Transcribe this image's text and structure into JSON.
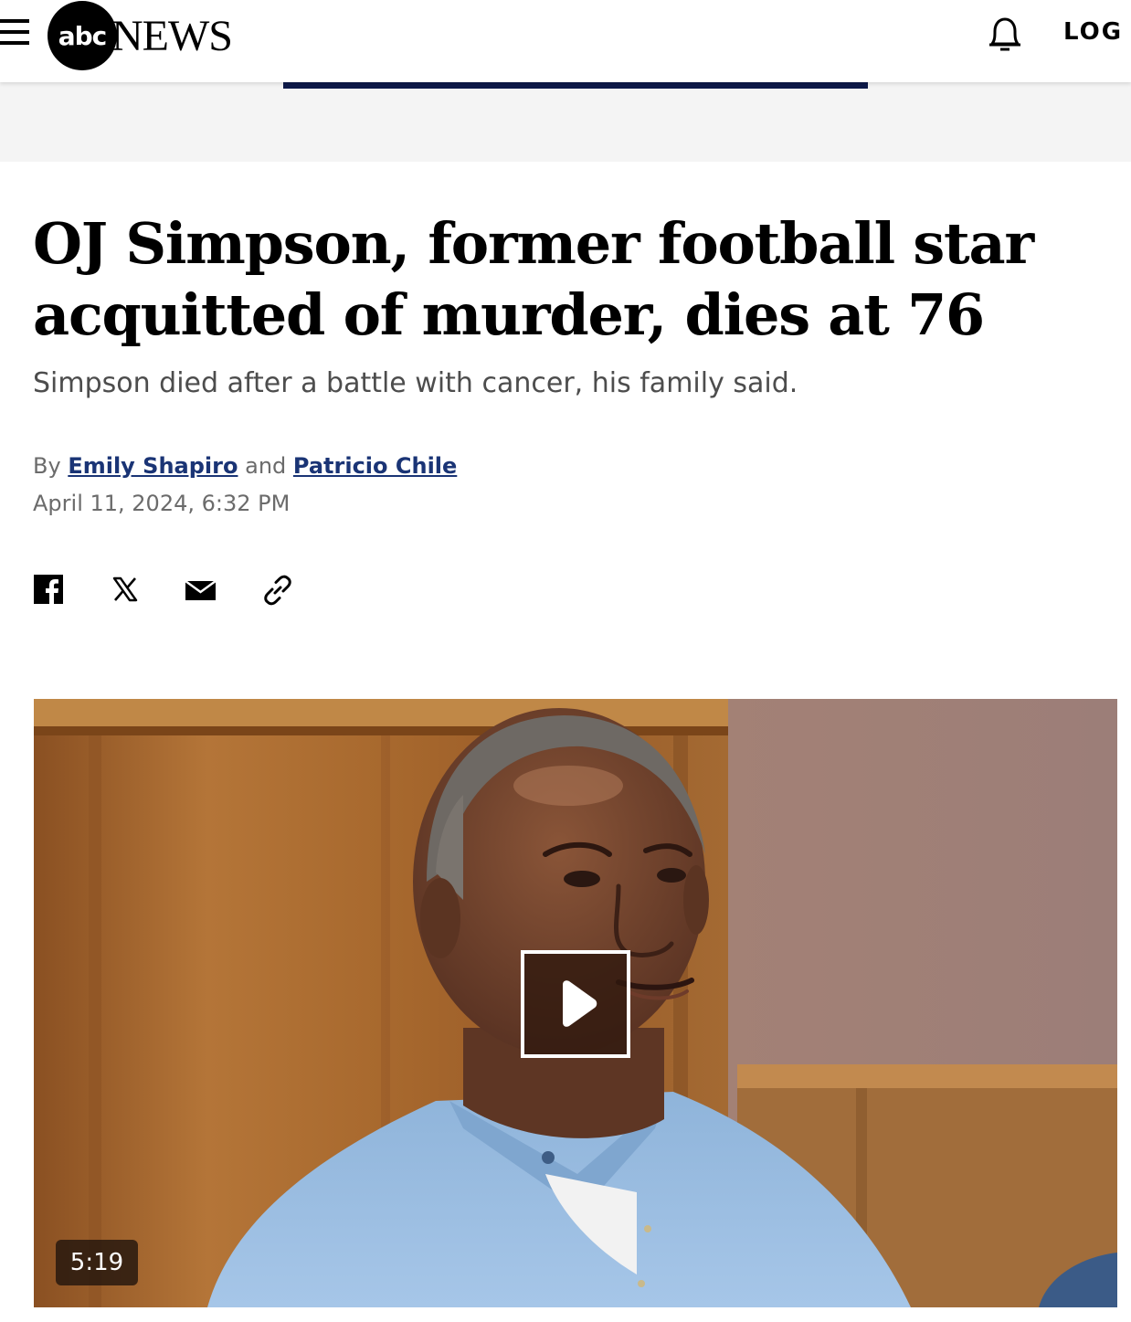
{
  "header": {
    "logo_mark": "abc",
    "logo_wordmark": "NEWS",
    "login_label": "LOG I",
    "icons": [
      "menu-icon",
      "bell-icon"
    ]
  },
  "article": {
    "headline": "OJ Simpson, former football star acquitted of murder, dies at 76",
    "subheadline": "Simpson died after a battle with cancer, his family said.",
    "byline": {
      "prefix": "By",
      "author_1": "Emily Shapiro",
      "conjunction": "and",
      "author_2": "Patricio Chile"
    },
    "date": "April 11, 2024, 6:32 PM",
    "share_icons": [
      "facebook-icon",
      "x-icon",
      "email-icon",
      "link-icon"
    ]
  },
  "video": {
    "duration": "5:19",
    "icon": "play-icon"
  },
  "colors": {
    "byline_link": "#1a3475",
    "subhead_text": "#4d4d4d",
    "meta_text": "#6b6b6b",
    "ad_strip": "#f4f4f4",
    "ad_banner": "#0e1a4a"
  }
}
